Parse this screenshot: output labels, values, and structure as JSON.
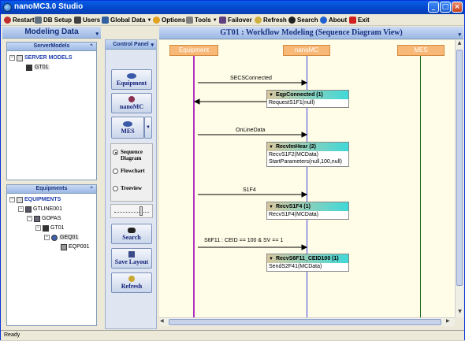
{
  "window": {
    "title": "nanoMC3.0 Studio"
  },
  "toolbar": {
    "items": [
      {
        "label": "Restart",
        "icon": "restart-icon",
        "color": "#c03030"
      },
      {
        "label": "DB Setup",
        "icon": "db-setup-icon",
        "color": "#607080"
      },
      {
        "label": "Users",
        "icon": "users-icon",
        "color": "#404040"
      },
      {
        "label": "Global Data",
        "icon": "global-data-icon",
        "color": "#3060a0"
      },
      {
        "label": "Options",
        "icon": "options-icon",
        "color": "#e0a020"
      },
      {
        "label": "Tools",
        "icon": "tools-icon",
        "color": "#808080"
      },
      {
        "label": "Failover",
        "icon": "failover-icon",
        "color": "#604080"
      },
      {
        "label": "Refresh",
        "icon": "refresh-icon",
        "color": "#d0b040"
      },
      {
        "label": "Search",
        "icon": "search-icon",
        "color": "#202020"
      },
      {
        "label": "About",
        "icon": "about-icon",
        "color": "#2060d0"
      },
      {
        "label": "Exit",
        "icon": "exit-icon",
        "color": "#d02020"
      }
    ]
  },
  "left": {
    "header": "Modeling Data",
    "server_models": {
      "header": "ServerModels",
      "root": "SERVER MODELS",
      "child": "GT01"
    },
    "equipments": {
      "header": "Equipments",
      "root": "EQUIPMENTS",
      "items": [
        "GTLINE001",
        "GOPAS",
        "GT01",
        "GEQ01",
        "EQP001"
      ]
    }
  },
  "control_panel": {
    "header": "Control Panel",
    "buttons": {
      "equipment": "Equipment",
      "nanomc": "nanoMC",
      "mes": "MES",
      "search": "Search",
      "save_layout": "Save Layout",
      "refresh": "Refresh"
    },
    "views": {
      "sequence_l1": "Sequence",
      "sequence_l2": "Diagram",
      "flowchart": "Flowchart",
      "treeview": "Treeview",
      "selected": "Sequence Diagram"
    }
  },
  "diagram": {
    "title": "GT01 : Workflow Modeling (Sequence Diagram View)",
    "lifelines": [
      "Equipment",
      "nanoMC",
      "MES"
    ],
    "messages": [
      {
        "label": "SECSConnected"
      },
      {
        "label": "OnLineData"
      },
      {
        "label": "S1F4"
      },
      {
        "label": "S6F11 : CEID  == 100  &  SV == 1"
      }
    ],
    "notes": [
      {
        "title": "EqpConnected (1)",
        "lines": [
          "RequestS1F1(null)"
        ]
      },
      {
        "title": "RecvImHear (2)",
        "lines": [
          "RecvS1F2(MCData)",
          "StartParameters(null,100,null)"
        ]
      },
      {
        "title": "RecvS1F4 (1)",
        "lines": [
          "RecvS1F4(MCData)"
        ]
      },
      {
        "title": "RecvS6F11_CEID100 (1)",
        "lines": [
          "SendS2F41(MCData)"
        ]
      }
    ]
  },
  "status": {
    "text": "Ready"
  }
}
